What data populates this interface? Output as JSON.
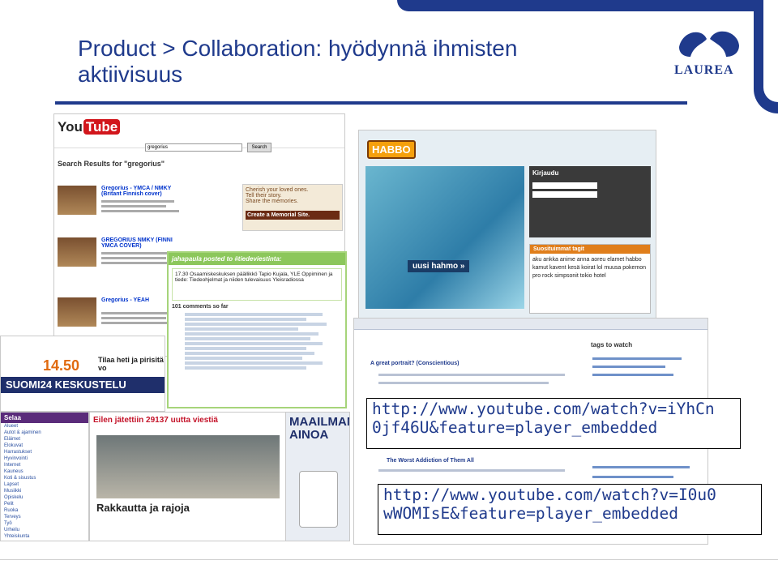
{
  "slide": {
    "title_line1": "Product > Collaboration: hyödynnä ihmisten",
    "title_line2": "aktiivisuus",
    "logo_text": "LAUREA",
    "colors": {
      "brand": "#1f3a8c",
      "accent": "#d2161c"
    }
  },
  "links": {
    "url1": "http://www.youtube.com/watch?v=iYhCn0jf46U&feature=player_embedded",
    "url1_line1": "http://www.youtube.com/watch?v=iYhCn",
    "url1_line2": "0jf46U&feature=player_embedded",
    "url2": "http://www.youtube.com/watch?v=I0u0wWOMIsE&feature=player_embedded",
    "url2_line1": "http://www.youtube.com/watch?v=I0u0",
    "url2_line2": "wWOMIsE&feature=player_embedded"
  },
  "screenshots": {
    "youtube": {
      "logo": "You",
      "logo_box": "Tube",
      "search_value": "gregorius",
      "search_button": "Search",
      "results_title": "Search Results for \"gregorius\"",
      "ad_line1": "Cherish your loved ones.",
      "ad_line2": "Tell their story.",
      "ad_line3": "Share the memories.",
      "ad_banner": "Create a Memorial Site.",
      "rows": [
        "Gregorius - YMCA / NMKY (Britant Finnish cover)",
        "GREGORIUS NMKY (FINNI YMCA COVER)",
        "Gregorius - YEAH"
      ]
    },
    "habbo": {
      "logo": "HABBO",
      "login_title": "Kirjaudu",
      "tags_title": "Suosituimmat tagit",
      "tags": "aku ankka anime anna aoreu elamet habbo kamut kavent kesä koirat lol muusa pokemon pro rock simpsonit tokio hotel",
      "new_banner": "uusi hahmo »"
    },
    "jaiku": {
      "header": "jahapaula posted to #tiedeviestinta:",
      "post": "17.30 Osaamiskeskuksen päällikkö Tapio Kujala, YLE Oppiminen ja tiede: Tiedeohjelmat ja niiden tulevaisuus Yleisradiossa",
      "comments": "101 comments so far"
    },
    "suomi24": {
      "price": "14.50",
      "promo": "Tilaa heti ja pirisitä vo",
      "banner": "SUOMI24 KESKUSTELU",
      "list_title": "Selaa",
      "list_items": [
        "Alueet",
        "Autot & ajaminen",
        "Eläimet",
        "Elokuvat",
        "Harrastukset",
        "Hyvinvointi",
        "Internet",
        "Kauneus",
        "Koti & sisustus",
        "Lapset",
        "Musiikki",
        "Opiskelu",
        "Pelit",
        "Ruoka",
        "Terveys",
        "Työ",
        "Urheilu",
        "Yhteiskunta"
      ],
      "main_title": "Eilen jätettiin 29137 uutta viestiä",
      "main_big": "Rakkautta ja rajoja"
    },
    "maailman": {
      "title": "MAAILMAN AINOA"
    },
    "youtube2": {
      "tags_title": "tags to watch",
      "item1": "A great portrait? (Conscientious)",
      "item2": "The Worst Addiction of Them All"
    }
  }
}
